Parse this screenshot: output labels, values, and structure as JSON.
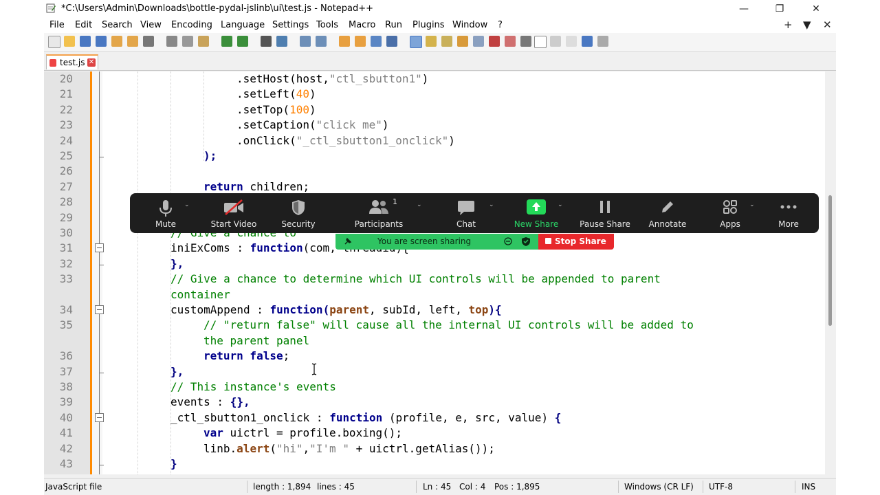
{
  "window": {
    "title": "*C:\\Users\\Admin\\Downloads\\bottle-pydal-jslinb\\ui\\test.js - Notepad++",
    "minimize": "—",
    "restore": "❐",
    "close": "✕"
  },
  "menu": {
    "items": [
      "File",
      "Edit",
      "Search",
      "View",
      "Encoding",
      "Language",
      "Settings",
      "Tools",
      "Macro",
      "Run",
      "Plugins",
      "Window",
      "?"
    ],
    "right": [
      "+",
      "▼",
      "✕"
    ]
  },
  "tab": {
    "label": "test.js",
    "close": "✕"
  },
  "editor": {
    "lines": [
      {
        "n": "20",
        "parts": [
          [
            ".setHost(host,",
            ""
          ],
          [
            "\"ctl_sbutton1\"",
            "str"
          ],
          [
            ")",
            ""
          ]
        ]
      },
      {
        "n": "21",
        "parts": [
          [
            ".setLeft(",
            ""
          ],
          [
            "40",
            "num"
          ],
          [
            ")",
            ""
          ]
        ]
      },
      {
        "n": "22",
        "parts": [
          [
            ".setTop(",
            ""
          ],
          [
            "100",
            "num"
          ],
          [
            ")",
            ""
          ]
        ]
      },
      {
        "n": "23",
        "parts": [
          [
            ".setCaption(",
            ""
          ],
          [
            "\"click me\"",
            "str"
          ],
          [
            ")",
            ""
          ]
        ]
      },
      {
        "n": "24",
        "parts": [
          [
            ".onClick(",
            ""
          ],
          [
            "\"_ctl_sbutton1_onclick\"",
            "str"
          ],
          [
            ")",
            ""
          ]
        ]
      },
      {
        "n": "25",
        "parts": [
          [
            ");",
            "op"
          ]
        ]
      },
      {
        "n": "26",
        "parts": []
      },
      {
        "n": "27",
        "parts": [
          [
            "return",
            "kw"
          ],
          [
            " children;",
            ""
          ]
        ]
      },
      {
        "n": "28",
        "parts": []
      },
      {
        "n": "29",
        "parts": []
      },
      {
        "n": "30",
        "parts": [
          [
            "// Give a chance to",
            "cm"
          ]
        ]
      },
      {
        "n": "31",
        "parts": [
          [
            "iniExComs : ",
            ""
          ],
          [
            "function",
            "kw"
          ],
          [
            "(com, threadid){",
            ""
          ]
        ]
      },
      {
        "n": "32",
        "parts": [
          [
            "},",
            "op"
          ]
        ]
      },
      {
        "n": "33",
        "parts": [
          [
            "// Give a chance to determine which UI controls will be appended to parent",
            "cm"
          ]
        ]
      },
      {
        "n": "",
        "parts": [
          [
            "container",
            "cm"
          ]
        ]
      },
      {
        "n": "34",
        "parts": [
          [
            "customAppend : ",
            ""
          ],
          [
            "function",
            "kw"
          ],
          [
            "(",
            "op"
          ],
          [
            "parent",
            "pm"
          ],
          [
            ", subId, left, ",
            ""
          ],
          [
            "top",
            "pm"
          ],
          [
            "){",
            "op"
          ]
        ]
      },
      {
        "n": "35",
        "parts": [
          [
            "// \"return false\" will cause all the internal UI controls will be added to",
            "cm"
          ]
        ]
      },
      {
        "n": "",
        "parts": [
          [
            "the parent panel",
            "cm"
          ]
        ]
      },
      {
        "n": "36",
        "parts": [
          [
            "return false",
            "kw"
          ],
          [
            ";",
            ""
          ]
        ]
      },
      {
        "n": "37",
        "parts": [
          [
            "},",
            "op"
          ]
        ]
      },
      {
        "n": "38",
        "parts": [
          [
            "// This instance's events",
            "cm"
          ]
        ]
      },
      {
        "n": "39",
        "parts": [
          [
            "events : ",
            ""
          ],
          [
            "{},",
            "op"
          ]
        ]
      },
      {
        "n": "40",
        "parts": [
          [
            "_ctl_sbutton1_onclick : ",
            ""
          ],
          [
            "function",
            "kw"
          ],
          [
            " (profile, e, src, value) ",
            ""
          ],
          [
            "{",
            "op"
          ]
        ]
      },
      {
        "n": "41",
        "parts": [
          [
            "var",
            "kw"
          ],
          [
            " uictrl = profile.boxing();",
            ""
          ]
        ]
      },
      {
        "n": "42",
        "parts": [
          [
            "linb.",
            ""
          ],
          [
            "alert",
            "pm"
          ],
          [
            "(",
            ""
          ],
          [
            "\"hi\"",
            "str"
          ],
          [
            ",",
            ""
          ],
          [
            "\"I'm \"",
            "str"
          ],
          [
            " + uictrl.getAlias());",
            ""
          ]
        ]
      },
      {
        "n": "43",
        "parts": [
          [
            "}",
            "op"
          ]
        ]
      }
    ]
  },
  "zoom": {
    "buttons": [
      {
        "label": "Mute",
        "icon": "microphone-icon"
      },
      {
        "label": "Start Video",
        "icon": "video-off-icon"
      },
      {
        "label": "Security",
        "icon": "shield-icon"
      },
      {
        "label": "Participants",
        "icon": "participants-icon",
        "count": "1"
      },
      {
        "label": "Chat",
        "icon": "chat-icon"
      },
      {
        "label": "New Share",
        "icon": "share-arrow-icon"
      },
      {
        "label": "Pause Share",
        "icon": "pause-icon"
      },
      {
        "label": "Annotate",
        "icon": "pencil-icon"
      },
      {
        "label": "Apps",
        "icon": "apps-icon"
      },
      {
        "label": "More",
        "icon": "more-icon"
      }
    ],
    "sharing_text": "You are screen sharing",
    "stop_share": "Stop Share",
    "colors": {
      "bar": "#1e1e1e",
      "new_share": "#23d959",
      "sharing": "#2ec462",
      "stop": "#e8282c"
    }
  },
  "status": {
    "file_type": "JavaScript file",
    "length": "length : 1,894",
    "lines": "lines : 45",
    "ln": "Ln : 45",
    "col": "Col : 4",
    "pos": "Pos : 1,895",
    "eol": "Windows (CR LF)",
    "encoding": "UTF-8",
    "mode": "INS"
  }
}
